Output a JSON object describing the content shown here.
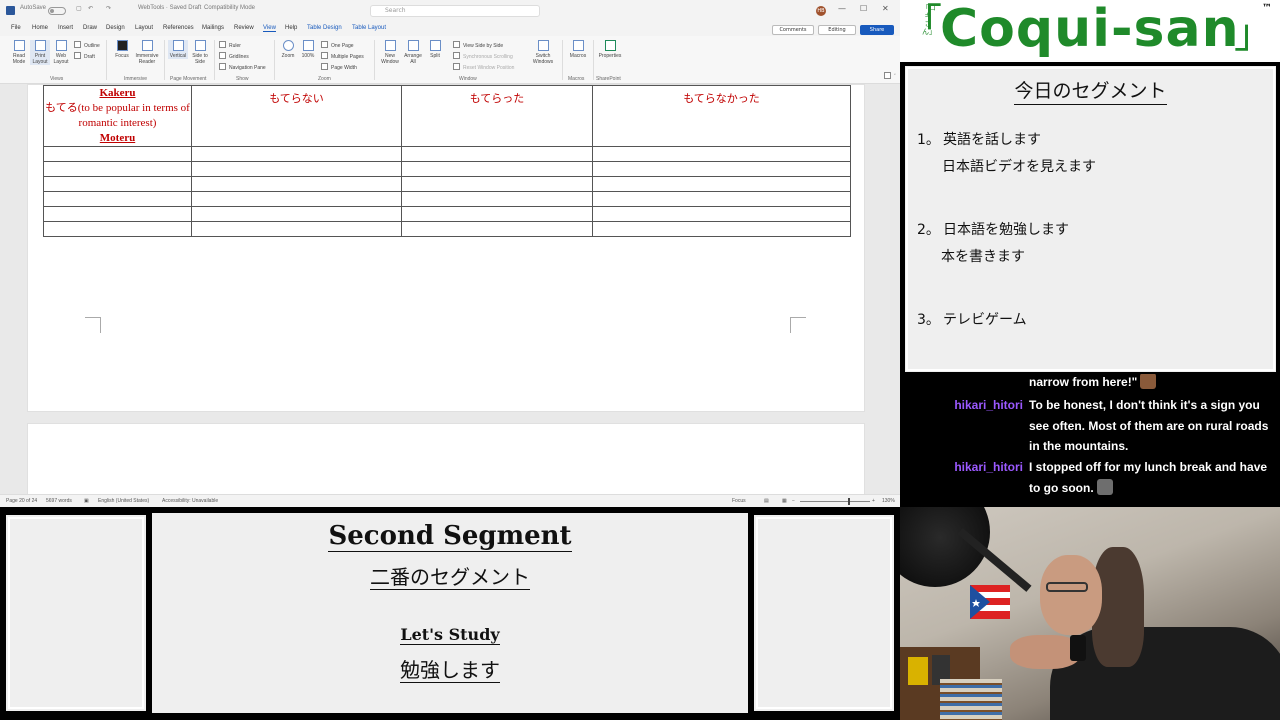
{
  "word": {
    "titlebar": {
      "autosave_label": "AutoSave",
      "doc_name": "WebTools · Saved Draft",
      "compat_mode": "Compatibility Mode",
      "search_placeholder": "Search",
      "user_initials": "HB",
      "minimize": "—",
      "maximize": "☐",
      "close": "✕"
    },
    "menu_tabs": [
      "File",
      "Home",
      "Insert",
      "Draw",
      "Design",
      "Layout",
      "References",
      "Mailings",
      "Review",
      "View",
      "Help",
      "Table Design",
      "Table Layout"
    ],
    "active_tab": "View",
    "comments_label": "Comments",
    "editing_label": "Editing",
    "share_label": "Share",
    "ribbon": {
      "views": {
        "read_mode": "Read Mode",
        "print_layout": "Print Layout",
        "web_layout": "Web Layout",
        "outline": "Outline",
        "draft": "Draft",
        "group": "Views"
      },
      "immersive": {
        "focus": "Focus",
        "immersive_reader": "Immersive Reader",
        "group": "Immersive"
      },
      "page_movement": {
        "vertical": "Vertical",
        "side_to_side": "Side to Side",
        "group": "Page Movement"
      },
      "show": {
        "ruler": "Ruler",
        "gridlines": "Gridlines",
        "navigation_pane": "Navigation Pane",
        "group": "Show"
      },
      "zoom": {
        "zoom": "Zoom",
        "hundred": "100%",
        "one_page": "One Page",
        "multiple_pages": "Multiple Pages",
        "page_width": "Page Width",
        "group": "Zoom"
      },
      "window": {
        "new_window": "New Window",
        "arrange_all": "Arrange All",
        "split": "Split",
        "side_by_side": "View Side by Side",
        "sync_scroll": "Synchronous Scrolling",
        "reset_position": "Reset Window Position",
        "switch_windows": "Switch Windows",
        "group": "Window"
      },
      "macros": {
        "macros": "Macros",
        "group": "Macros"
      },
      "sharepoint": {
        "properties": "Properties",
        "group": "SharePoint"
      }
    },
    "table": {
      "head_lines": [
        "Kakeru"
      ],
      "head_cell": {
        "jp": "もてる(to be popular in terms of romantic interest)",
        "romaji": "Moteru"
      },
      "conjugations": [
        "もてらない",
        "もてらった",
        "もてらなかった"
      ]
    },
    "statusbar": {
      "page": "Page 20 of 24",
      "words": "5697 words",
      "language": "English (United States)",
      "accessibility": "Accessibility: Unavailable",
      "focus": "Focus",
      "zoom": "130%"
    }
  },
  "logo": {
    "small": "「コキさん」",
    "main": "Coqui-san",
    "open_bracket": "「",
    "close_bracket": "」",
    "tm": "™"
  },
  "segment_panel": {
    "title": "今日のセグメント",
    "items": [
      {
        "num": "1。",
        "main": "英語を話します",
        "sub": "日本語ビデオを見えます"
      },
      {
        "num": "2。",
        "main": "日本語を勉強します",
        "sub": "本を書きます"
      },
      {
        "num": "3。",
        "main": "テレビゲーム",
        "sub": ""
      }
    ]
  },
  "chat": [
    {
      "user": "",
      "text": "narrow from here!\""
    },
    {
      "user": "hikari_hitori",
      "text": "To be honest, I don't think it's a sign you see often. Most of them are on rural roads in the mountains."
    },
    {
      "user": "hikari_hitori",
      "text": "I stopped off for my lunch break and have to go soon."
    }
  ],
  "bottom": {
    "seg_heading": "Second Segment",
    "seg_sub": "二番のセグメント",
    "study_heading": "Let's Study",
    "study_sub": "勉強します"
  },
  "colors": {
    "brand_green": "#1f8a2a",
    "chat_user": "#9b59ff",
    "table_red": "#c00000",
    "word_blue": "#185abd"
  }
}
